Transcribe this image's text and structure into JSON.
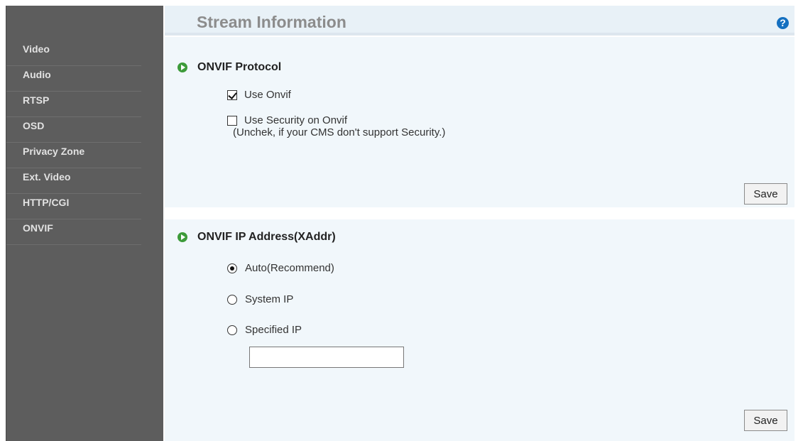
{
  "sidebar": {
    "items": [
      {
        "label": "Video"
      },
      {
        "label": "Audio"
      },
      {
        "label": "RTSP"
      },
      {
        "label": "OSD"
      },
      {
        "label": "Privacy Zone"
      },
      {
        "label": "Ext. Video"
      },
      {
        "label": "HTTP/CGI"
      },
      {
        "label": "ONVIF"
      }
    ]
  },
  "header": {
    "title": "Stream Information",
    "help_glyph": "?"
  },
  "onvif_protocol": {
    "title": "ONVIF Protocol",
    "use_onvif": {
      "label": "Use Onvif",
      "checked": true
    },
    "use_security": {
      "label": "Use Security on Onvif",
      "checked": false
    },
    "note": "(Unchek, if your CMS don't support Security.)",
    "save_label": "Save"
  },
  "onvif_ip": {
    "title": "ONVIF IP Address(XAddr)",
    "options": [
      {
        "label": "Auto(Recommend)",
        "selected": true
      },
      {
        "label": "System IP",
        "selected": false
      },
      {
        "label": "Specified IP",
        "selected": false
      }
    ],
    "specified_ip_value": "",
    "save_label": "Save"
  },
  "icons": {
    "help": "help-icon",
    "section_bullet": "play-bullet-icon"
  },
  "colors": {
    "sidebar_bg": "#5d5d5d",
    "panel_bg": "#f1f7fb",
    "bullet": "#3d9b3a",
    "help": "#1570c0"
  }
}
